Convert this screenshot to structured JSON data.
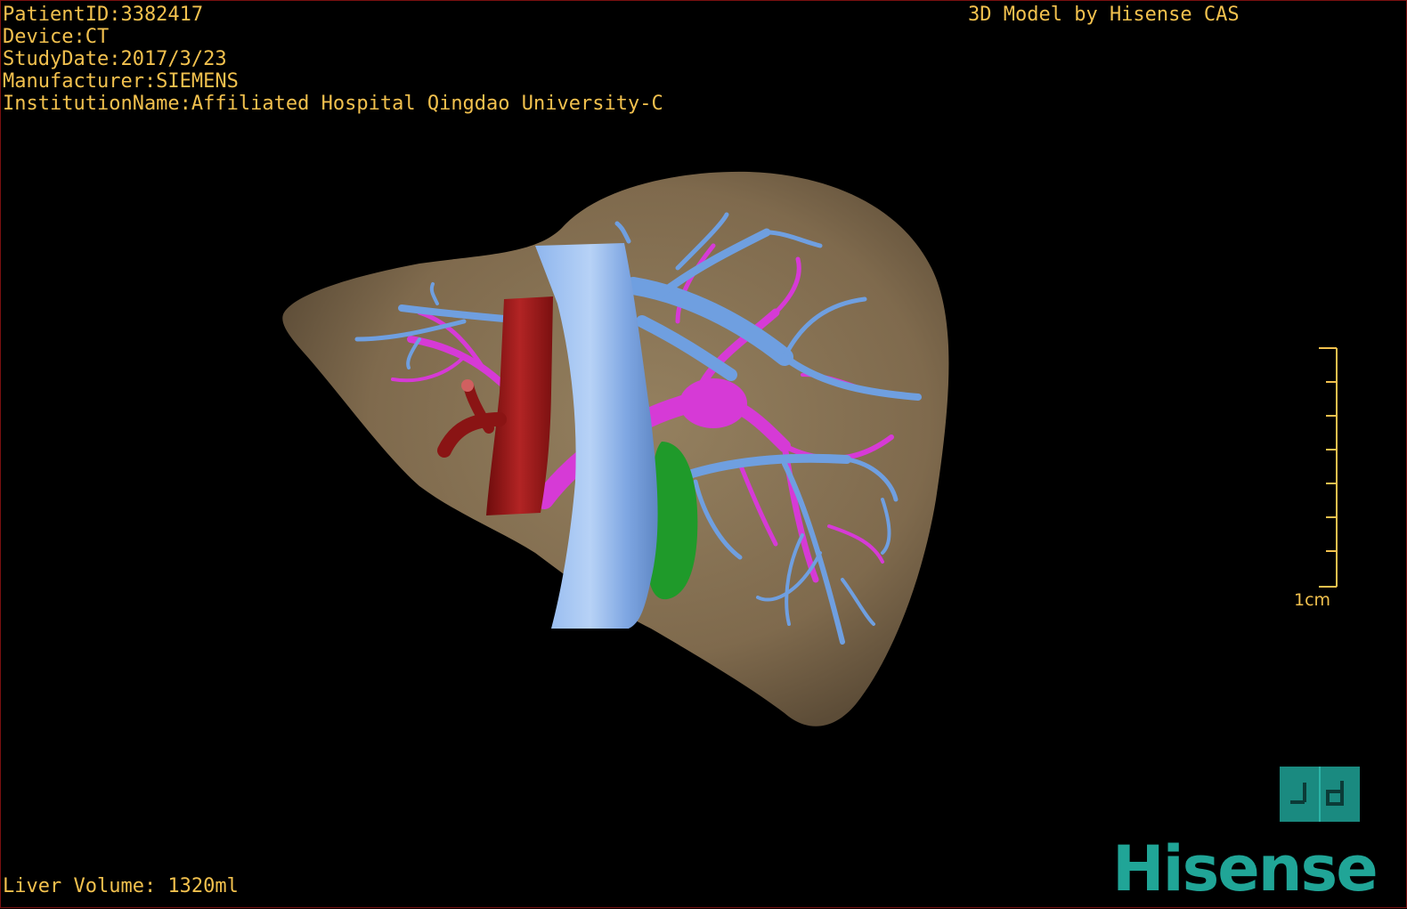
{
  "patient_info": {
    "patient_id": "PatientID:3382417",
    "device": "Device:CT",
    "study_date": "StudyDate:2017/3/23",
    "manufacturer": "Manufacturer:SIEMENS",
    "institution": "InstitutionName:Affiliated Hospital Qingdao University-C"
  },
  "model_credit": "3D Model by Hisense CAS",
  "liver_volume": "Liver Volume: 1320ml",
  "scale": {
    "label": "1cm"
  },
  "vendor": {
    "logo_text": "Hisense",
    "tile_icon": "view-orientation-icon"
  },
  "colors": {
    "overlay_text": "#f2c14e",
    "liver": "#8a7455",
    "hepatic_vein": "#6f9fe0",
    "portal_vein": "#d63ad6",
    "artery": "#a01818",
    "gallbladder": "#1f9a2a",
    "brand": "#20a597"
  }
}
